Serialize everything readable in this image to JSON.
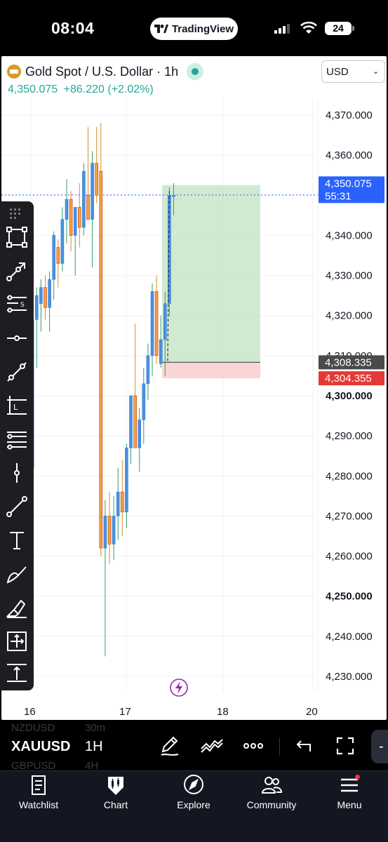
{
  "status_bar": {
    "time": "08:04",
    "app_pill_label": "TradingView",
    "battery_level": "24"
  },
  "chart_header": {
    "symbol_title": "Gold Spot / U.S. Dollar · 1h",
    "last_price": "4,350.075",
    "change": "+86.220 (+2.02%)",
    "currency": "USD"
  },
  "price_axis": {
    "ticks": [
      "4,370.000",
      "4,360.000",
      "4,340.000",
      "4,330.000",
      "4,320.000",
      "4,300.000",
      "4,290.000",
      "4,280.000",
      "4,270.000",
      "4,260.000",
      "4,250.000",
      "4,240.000",
      "4,230.000"
    ],
    "partial_tick": "4,310.000",
    "labels": {
      "target": "4,352.565",
      "current": "4,350.075",
      "countdown": "55:31",
      "entry": "4,308.335",
      "stop": "4,304.355"
    }
  },
  "time_axis": {
    "ticks": [
      "16",
      "17",
      "18",
      "20"
    ]
  },
  "chart_data": {
    "type": "candlestick",
    "ylim": [
      4226,
      4376
    ],
    "x_ticks": [
      "16",
      "17",
      "18",
      "20"
    ],
    "candles": [
      {
        "o": 4276,
        "h": 4281,
        "l": 4275,
        "c": 4279
      },
      {
        "o": 4279,
        "h": 4285,
        "l": 4276,
        "c": 4284
      },
      {
        "o": 4282,
        "h": 4320,
        "l": 4281,
        "c": 4319
      },
      {
        "o": 4319,
        "h": 4327,
        "l": 4307,
        "c": 4325
      },
      {
        "o": 4323,
        "h": 4329,
        "l": 4316,
        "c": 4327
      },
      {
        "o": 4327,
        "h": 4330,
        "l": 4319,
        "c": 4322
      },
      {
        "o": 4322,
        "h": 4331,
        "l": 4316,
        "c": 4329
      },
      {
        "o": 4329,
        "h": 4341,
        "l": 4324,
        "c": 4340
      },
      {
        "o": 4337,
        "h": 4339,
        "l": 4327,
        "c": 4333
      },
      {
        "o": 4333,
        "h": 4347,
        "l": 4331,
        "c": 4344
      },
      {
        "o": 4344,
        "h": 4354,
        "l": 4338,
        "c": 4349
      },
      {
        "o": 4349,
        "h": 4351,
        "l": 4336,
        "c": 4340
      },
      {
        "o": 4340,
        "h": 4347,
        "l": 4330,
        "c": 4347
      },
      {
        "o": 4347,
        "h": 4353,
        "l": 4337,
        "c": 4342
      },
      {
        "o": 4342,
        "h": 4358,
        "l": 4340,
        "c": 4356
      },
      {
        "o": 4350,
        "h": 4367,
        "l": 4349,
        "c": 4344
      },
      {
        "o": 4344,
        "h": 4361,
        "l": 4332,
        "c": 4358
      },
      {
        "o": 4358,
        "h": 4367,
        "l": 4348,
        "c": 4350
      },
      {
        "o": 4356,
        "h": 4368,
        "l": 4260,
        "c": 4262
      },
      {
        "o": 4262,
        "h": 4274,
        "l": 4235,
        "c": 4270
      },
      {
        "o": 4270,
        "h": 4276,
        "l": 4258,
        "c": 4263
      },
      {
        "o": 4263,
        "h": 4275,
        "l": 4259,
        "c": 4270
      },
      {
        "o": 4270,
        "h": 4282,
        "l": 4264,
        "c": 4276
      },
      {
        "o": 4276,
        "h": 4284,
        "l": 4265,
        "c": 4271
      },
      {
        "o": 4271,
        "h": 4288,
        "l": 4267,
        "c": 4287
      },
      {
        "o": 4287,
        "h": 4300,
        "l": 4283,
        "c": 4300
      },
      {
        "o": 4300,
        "h": 4318,
        "l": 4292,
        "c": 4287
      },
      {
        "o": 4287,
        "h": 4297,
        "l": 4281,
        "c": 4294
      },
      {
        "o": 4294,
        "h": 4307,
        "l": 4288,
        "c": 4303
      },
      {
        "o": 4303,
        "h": 4313,
        "l": 4299,
        "c": 4310
      },
      {
        "o": 4310,
        "h": 4328,
        "l": 4305,
        "c": 4326
      },
      {
        "o": 4326,
        "h": 4330,
        "l": 4308,
        "c": 4310
      },
      {
        "o": 4308,
        "h": 4320,
        "l": 4307,
        "c": 4314
      },
      {
        "o": 4314,
        "h": 4326,
        "l": 4305,
        "c": 4323
      },
      {
        "o": 4323,
        "h": 4352,
        "l": 4320,
        "c": 4350
      },
      {
        "o": 4350,
        "h": 4353,
        "l": 4345,
        "c": 4350
      }
    ],
    "position": {
      "target": 4352.565,
      "entry": 4308.335,
      "stop": 4304.355
    },
    "current_price": 4350.075
  },
  "toolbar": {
    "tools": [
      "rectangle",
      "trend-arrow",
      "fib-levels",
      "horizontal-ray",
      "trend-line",
      "long-position",
      "parallel-lines",
      "vertical-line",
      "line-segment",
      "text",
      "brush",
      "highlighter",
      "measure",
      "price-range"
    ]
  },
  "symbol_bar": {
    "symbol": "XAUUSD",
    "timeframe": "1H",
    "ghost_symbol_1": "NZDUSD",
    "ghost_tf_1": "30m",
    "ghost_symbol_2": "GBPUSD",
    "ghost_tf_2": "4H"
  },
  "bottom_nav": {
    "items": [
      {
        "label": "Watchlist"
      },
      {
        "label": "Chart"
      },
      {
        "label": "Explore"
      },
      {
        "label": "Community"
      },
      {
        "label": "Menu"
      }
    ]
  },
  "colors": {
    "up": "#4a90e2",
    "down": "#f0a33a",
    "profit_zone": "#c8e6c9",
    "loss_zone": "#f8d0d2",
    "target_label": "#2e9e47",
    "current_label": "#2962ff",
    "entry_label": "#4a4a4a",
    "stop_label": "#e53935"
  }
}
